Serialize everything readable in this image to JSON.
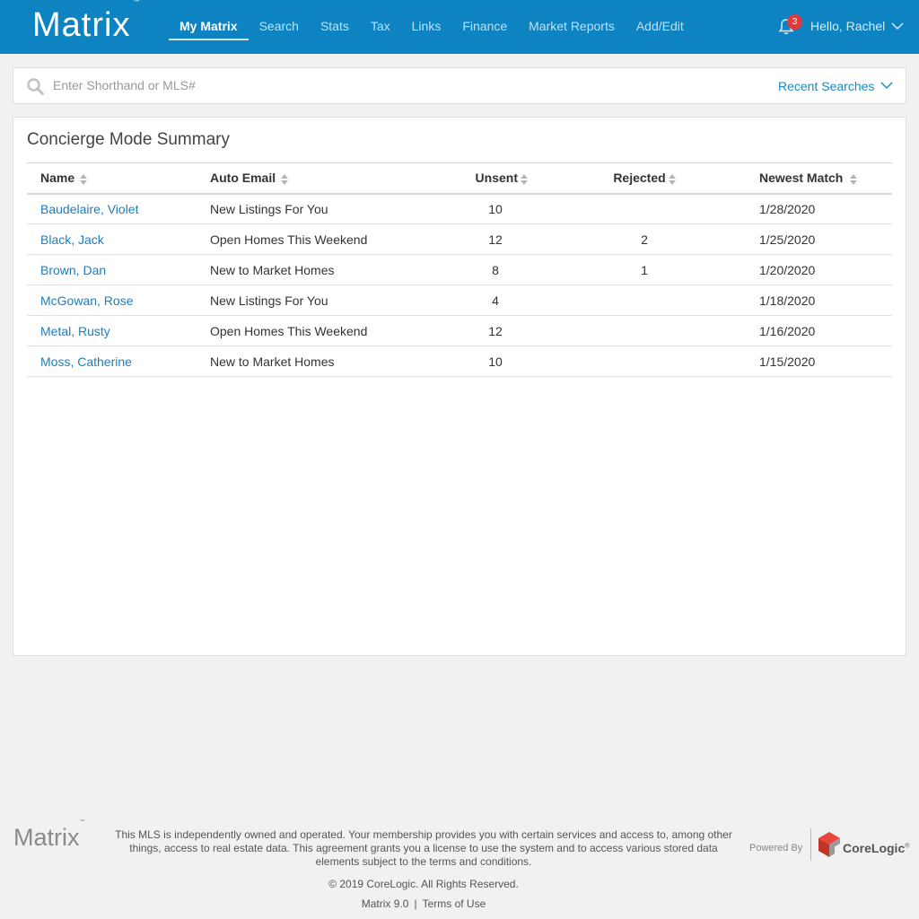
{
  "header": {
    "logo": "Matrix",
    "logo_tm": "™",
    "nav": [
      {
        "label": "My Matrix",
        "active": true
      },
      {
        "label": "Search"
      },
      {
        "label": "Stats"
      },
      {
        "label": "Tax"
      },
      {
        "label": "Links"
      },
      {
        "label": "Finance"
      },
      {
        "label": "Market Reports"
      },
      {
        "label": "Add/Edit"
      }
    ],
    "notification_count": "3",
    "greeting": "Hello, Rachel",
    "bell_icon": "bell-icon",
    "accent_color": "#0d84c1"
  },
  "search": {
    "placeholder": "Enter Shorthand or MLS#",
    "value": "",
    "recent_label": "Recent Searches"
  },
  "panel": {
    "title": "Concierge Mode Summary",
    "columns": {
      "name": "Name",
      "email": "Auto Email",
      "unsent": "Unsent",
      "rejected": "Rejected",
      "newest": "Newest Match"
    },
    "rows": [
      {
        "name": "Baudelaire, Violet",
        "email": "New Listings For You",
        "unsent": "10",
        "rejected": "",
        "newest": "1/28/2020"
      },
      {
        "name": "Black, Jack",
        "email": "Open Homes This Weekend",
        "unsent": "12",
        "rejected": "2",
        "newest": "1/25/2020"
      },
      {
        "name": "Brown, Dan",
        "email": "New to Market Homes",
        "unsent": "8",
        "rejected": "1",
        "newest": "1/20/2020"
      },
      {
        "name": "McGowan, Rose",
        "email": "New Listings For You",
        "unsent": "4",
        "rejected": "",
        "newest": "1/18/2020"
      },
      {
        "name": "Metal, Rusty",
        "email": "Open Homes This Weekend",
        "unsent": "12",
        "rejected": "",
        "newest": "1/16/2020"
      },
      {
        "name": "Moss, Catherine",
        "email": "New to Market Homes",
        "unsent": "10",
        "rejected": "",
        "newest": "1/15/2020"
      }
    ]
  },
  "footer": {
    "logo": "Matrix",
    "logo_tm": "™",
    "disclaimer": "This MLS is independently owned and operated. Your membership provides you with certain services and access to, among other things, access to real estate data. This agreement grants you a license to use the system and to access various stored data elements subject to the terms and conditions.",
    "copyright": "© 2019 CoreLogic. All Rights Reserved.",
    "version": "Matrix 9.0",
    "separator": "|",
    "terms": "Terms of Use",
    "powered_by": "Powered By",
    "brand": "CoreLogic",
    "brand_mark": "®"
  }
}
